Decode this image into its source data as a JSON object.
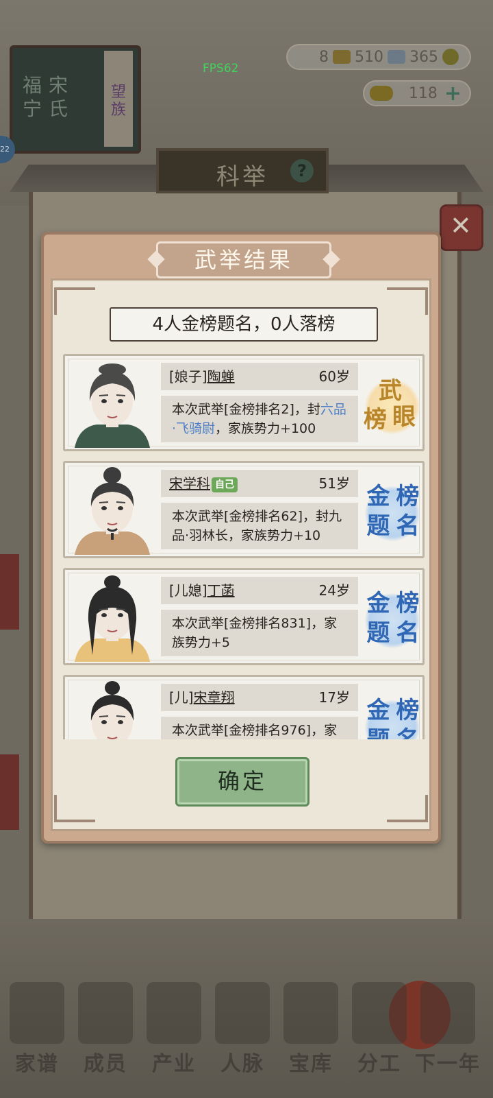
{
  "hud": {
    "fps": "FPS62",
    "clan_name_col1": "福宁",
    "clan_name_col2": "宋氏",
    "clan_rank": "望族",
    "resource_1": "8",
    "resource_2": "510",
    "resource_3": "365",
    "gold": "118",
    "left_badge": "22"
  },
  "screen": {
    "title": "科举",
    "help_symbol": "?"
  },
  "dialog": {
    "title": "武举结果",
    "summary": "4人金榜题名，0人落榜",
    "confirm_label": "确定",
    "results": [
      {
        "prefix": "[娘子]",
        "name": "陶蝉",
        "age": "60岁",
        "desc_before": "本次武举[金榜排名2]，封",
        "desc_link": "六品·飞骑尉",
        "desc_after": "，家族势力+100",
        "stamp": "武榜眼",
        "stamp_style": "gold",
        "portrait": "elderly-woman"
      },
      {
        "prefix": "",
        "name": "宋学科",
        "self_tag": "自己",
        "age": "51岁",
        "desc_before": "本次武举[金榜排名62]，封九品·羽林长，家族势力+10",
        "desc_link": "",
        "desc_after": "",
        "stamp": "金榜题名",
        "stamp_style": "blue",
        "portrait": "middle-aged-man"
      },
      {
        "prefix": "[儿媳]",
        "name": "丁菡",
        "age": "24岁",
        "desc_before": "本次武举[金榜排名831]，家族势力+5",
        "desc_link": "",
        "desc_after": "",
        "stamp": "金榜题名",
        "stamp_style": "blue",
        "portrait": "young-woman"
      },
      {
        "prefix": "[儿]",
        "name": "宋章翔",
        "age": "17岁",
        "desc_before": "本次武举[金榜排名976]，家",
        "desc_link": "",
        "desc_after": "",
        "stamp": "金榜题名",
        "stamp_style": "blue",
        "portrait": "young-man"
      }
    ]
  },
  "bottom_nav": [
    {
      "label": "家谱",
      "icon": "book-icon"
    },
    {
      "label": "成员",
      "icon": "person-icon"
    },
    {
      "label": "产业",
      "icon": "building-icon"
    },
    {
      "label": "人脉",
      "icon": "network-icon"
    },
    {
      "label": "宝库",
      "icon": "chest-icon"
    },
    {
      "label": "分工",
      "icon": "scroll-icon"
    },
    {
      "label": "下一年",
      "icon": "lantern-icon"
    }
  ],
  "colors": {
    "link_blue": "#4e7fc8",
    "stamp_gold": "#b8852a",
    "stamp_blue": "#2f67b4",
    "confirm_green": "#8fb48a"
  }
}
